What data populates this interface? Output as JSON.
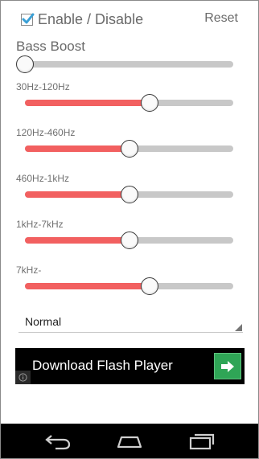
{
  "header": {
    "enable_label": "Enable / Disable",
    "enable_checked": true,
    "reset_label": "Reset"
  },
  "bass": {
    "label": "Bass Boost",
    "value": 0.0
  },
  "bands": [
    {
      "label": "30Hz-120Hz",
      "value": 0.6
    },
    {
      "label": "120Hz-460Hz",
      "value": 0.5
    },
    {
      "label": "460Hz-1kHz",
      "value": 0.5
    },
    {
      "label": "1kHz-7kHz",
      "value": 0.5
    },
    {
      "label": "7kHz-",
      "value": 0.6
    }
  ],
  "preset": {
    "value": "Normal"
  },
  "ad": {
    "text": "Download Flash Player",
    "button_icon": "arrow-right-icon",
    "info_icon": "info-icon"
  },
  "navbar": {
    "icons": [
      "back-icon",
      "home-icon",
      "recent-apps-icon"
    ]
  },
  "colors": {
    "fill": "#f26060",
    "track": "#c8c8c8",
    "ad_button": "#2fa556",
    "checkmark": "#3aa0d6"
  }
}
